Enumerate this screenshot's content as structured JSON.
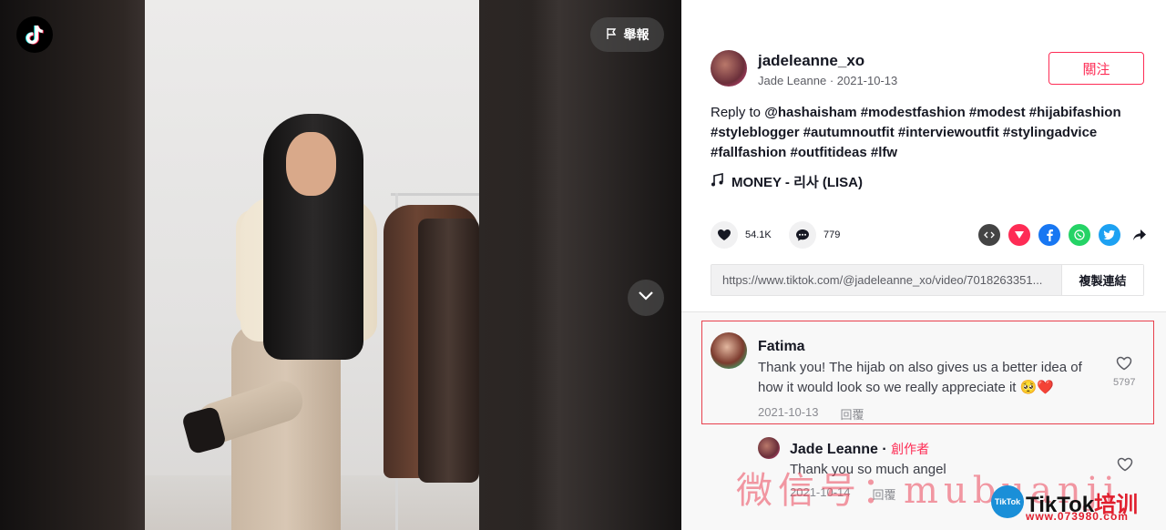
{
  "video": {
    "report_label": "舉報"
  },
  "author": {
    "username": "jadeleanne_xo",
    "display_name": "Jade Leanne",
    "date": "2021-10-13",
    "follow_label": "關注"
  },
  "description": {
    "prefix": "Reply to",
    "mention": "@hashaisham",
    "hashtags": [
      "#modestfashion",
      "#modest",
      "#hijabifashion",
      "#styleblogger",
      "#autumnoutfit",
      "#interviewoutfit",
      "#stylingadvice",
      "#fallfashion",
      "#outfitideas",
      "#lfw"
    ]
  },
  "music": {
    "title": "MONEY - 리사 (LISA)"
  },
  "stats": {
    "likes": "54.1K",
    "comments": "779"
  },
  "share": {
    "url": "https://www.tiktok.com/@jadeleanne_xo/video/7018263351...",
    "copy_label": "複製連結",
    "icons": [
      "embed-icon",
      "send-icon",
      "facebook-icon",
      "whatsapp-icon",
      "twitter-icon",
      "share-arrow-icon"
    ]
  },
  "comments": [
    {
      "name": "Fatima",
      "text_line1": "Thank you! The hijab on also gives us a better idea of",
      "text_line2": "how it would look so we really appreciate it 🥺❤️",
      "date": "2021-10-13",
      "reply_label": "回覆",
      "likes": "5797"
    },
    {
      "name": "Jade Leanne",
      "separator": "·",
      "badge": "創作者",
      "text": "Thank you so much angel",
      "date": "2021-10-14",
      "reply_label": "回覆"
    }
  ],
  "watermark": {
    "text": "微信号：mubuanji",
    "logo_text": "TikTok",
    "brand": "TikTok",
    "brand_suffix": "培训",
    "site": "www.073980.com"
  },
  "colors": {
    "accent": "#fe2c55",
    "text": "#161823",
    "muted": "#8a8b91"
  }
}
